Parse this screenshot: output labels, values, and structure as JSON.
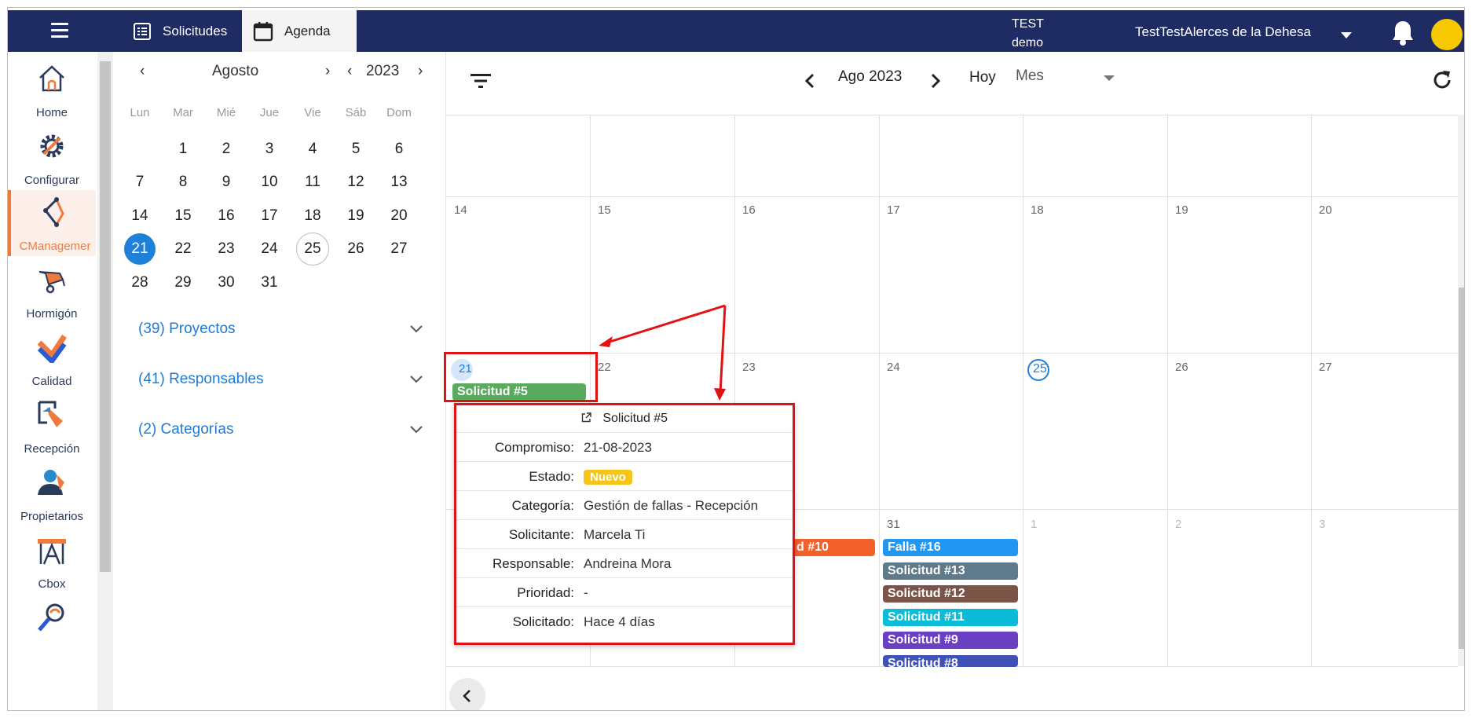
{
  "header": {
    "tabs": [
      {
        "label": "Solicitudes"
      },
      {
        "label": "Agenda"
      }
    ],
    "env_line1": "TEST",
    "env_line2": "demo",
    "user_name": "TestTestAlerces de la Dehesa",
    "colors": {
      "bar": "#1f2c64",
      "avatar": "#f7c800"
    }
  },
  "nav": {
    "items": [
      {
        "label": "Home",
        "icon": "home-icon"
      },
      {
        "label": "Configurar",
        "icon": "gear-icon"
      },
      {
        "label": "CManagemer",
        "icon": "cmanager-icon",
        "active": true
      },
      {
        "label": "Hormigón",
        "icon": "wheelbarrow-icon"
      },
      {
        "label": "Calidad",
        "icon": "check-icon"
      },
      {
        "label": "Recepción",
        "icon": "reception-icon"
      },
      {
        "label": "Propietarios",
        "icon": "owner-icon"
      },
      {
        "label": "Cbox",
        "icon": "cbox-icon"
      }
    ]
  },
  "mini_calendar": {
    "month": "Agosto",
    "year": "2023",
    "weekdays": [
      "Lun",
      "Mar",
      "Mié",
      "Jue",
      "Vie",
      "Sáb",
      "Dom"
    ],
    "weeks": [
      [
        "",
        "1",
        "2",
        "3",
        "4",
        "5",
        "6"
      ],
      [
        "7",
        "8",
        "9",
        "10",
        "11",
        "12",
        "13"
      ],
      [
        "14",
        "15",
        "16",
        "17",
        "18",
        "19",
        "20"
      ],
      [
        "21",
        "22",
        "23",
        "24",
        "25",
        "26",
        "27"
      ],
      [
        "28",
        "29",
        "30",
        "31",
        "",
        "",
        ""
      ]
    ],
    "selected": "21",
    "today": "25"
  },
  "filters": [
    {
      "label": "(39) Proyectos"
    },
    {
      "label": "(41) Responsables"
    },
    {
      "label": "(2) Categorías"
    }
  ],
  "calendar": {
    "period": "Ago 2023",
    "today_label": "Hoy",
    "view": "Mes",
    "week_row_1": [
      "14",
      "15",
      "16",
      "17",
      "18",
      "19",
      "20"
    ],
    "week_row_2": [
      "21",
      "22",
      "23",
      "24",
      "25",
      "26",
      "27"
    ],
    "week_row_3": [
      "",
      "",
      "",
      "31",
      "1",
      "2",
      "3"
    ],
    "events": {
      "e5": {
        "label": "Solicitud #5",
        "color": "#5aab5e"
      },
      "e10": {
        "label": "d #10",
        "color": "#f4602a"
      },
      "e16": {
        "label": "Falla #16",
        "color": "#2196f3"
      },
      "e13": {
        "label": "Solicitud #13",
        "color": "#5f7a8a"
      },
      "e12": {
        "label": "Solicitud #12",
        "color": "#7a5446"
      },
      "e11": {
        "label": "Solicitud #11",
        "color": "#0bbcd6"
      },
      "e9": {
        "label": "Solicitud #9",
        "color": "#6a3fc1"
      },
      "e8": {
        "label": "Solicitud #8",
        "color": "#3f51b5"
      }
    }
  },
  "popup": {
    "title": "Solicitud #5",
    "rows": [
      {
        "key": "Compromiso:",
        "value": "21-08-2023"
      },
      {
        "key": "Estado:",
        "value": "Nuevo"
      },
      {
        "key": "Categoría:",
        "value": "Gestión de fallas - Recepción"
      },
      {
        "key": "Solicitante:",
        "value": "Marcela Ti"
      },
      {
        "key": "Responsable:",
        "value": "Andreina Mora"
      },
      {
        "key": "Prioridad:",
        "value": "-"
      },
      {
        "key": "Solicitado:",
        "value": "Hace 4 días"
      }
    ]
  }
}
